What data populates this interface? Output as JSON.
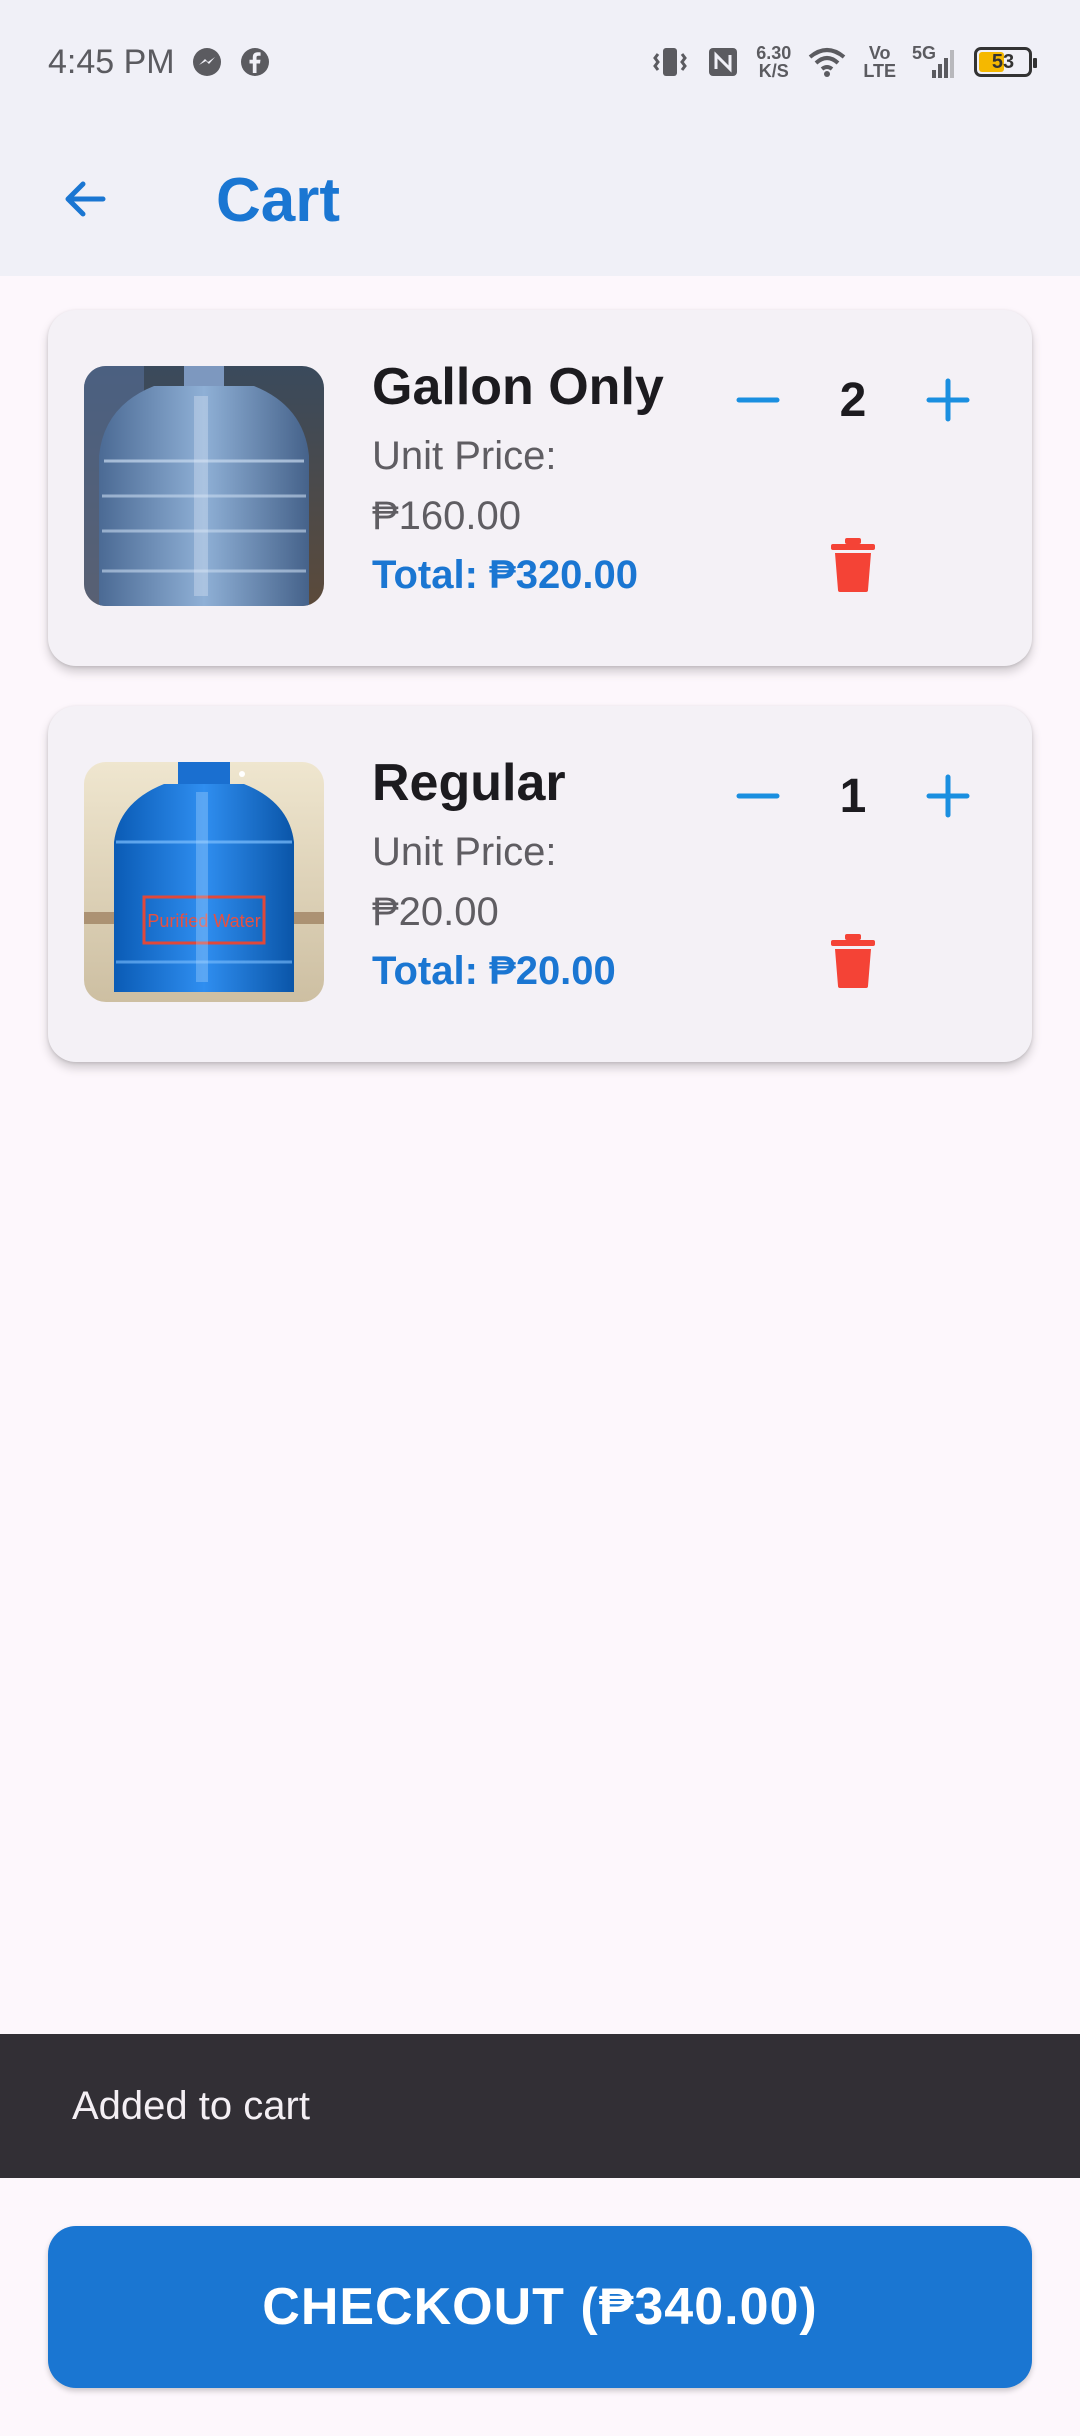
{
  "status_bar": {
    "time": "4:45 PM",
    "net_speed_value": "6.30",
    "net_speed_unit": "K/S",
    "volte_top": "Vo",
    "volte_bottom": "LTE",
    "network": "5G",
    "battery": "53",
    "battery_level": 0.53,
    "icons": [
      "messenger-icon",
      "facebook-icon",
      "vibrate-icon",
      "nfc-icon",
      "wifi-icon",
      "signal-icon",
      "battery-icon"
    ]
  },
  "app_bar": {
    "title": "Cart",
    "back_icon": "arrow-left-icon"
  },
  "colors": {
    "primary": "#1a76d2",
    "delete": "#f44336",
    "app_bar_bg": "#f0f0f7",
    "page_bg": "#fdf7fc",
    "card_bg": "#f4f1f6",
    "snackbar_bg": "#322f35"
  },
  "cart_items": [
    {
      "name": "Gallon Only",
      "unit_price_label": "Unit Price:",
      "unit_price": "₱160.00",
      "total": "Total: ₱320.00",
      "quantity": "2",
      "image": "gallon-bottle-image"
    },
    {
      "name": "Regular",
      "unit_price_label": "Unit Price:",
      "unit_price": "₱20.00",
      "total": "Total: ₱20.00",
      "quantity": "1",
      "image": "purified-water-bottle-image",
      "image_label": "Purified Water"
    }
  ],
  "snackbar": {
    "message": "Added to cart"
  },
  "checkout": {
    "label": "CHECKOUT (₱340.00)"
  }
}
